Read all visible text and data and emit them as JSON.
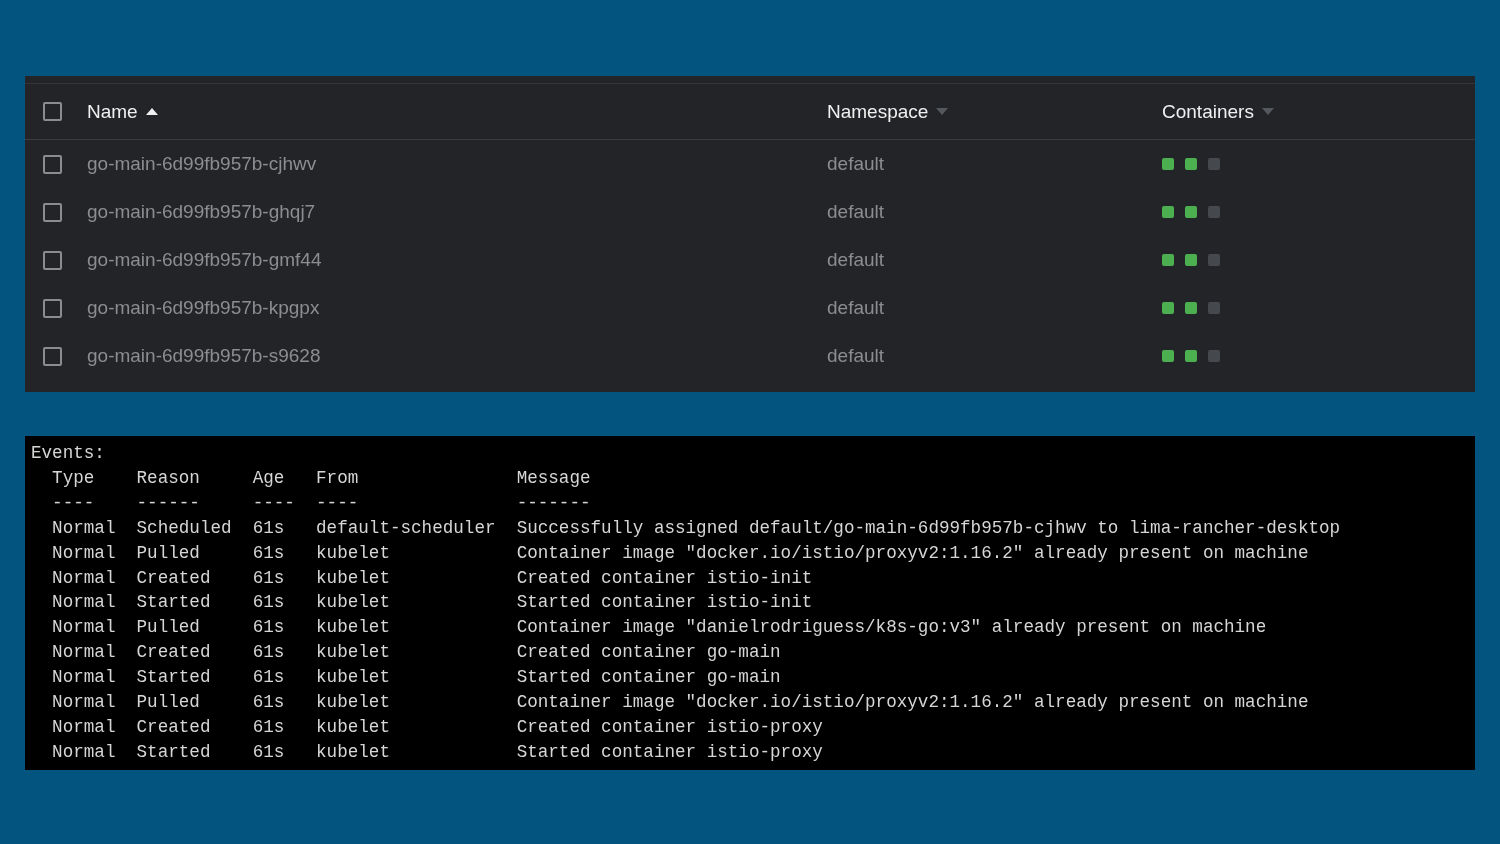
{
  "pods_table": {
    "select_all": {
      "checked": false
    },
    "columns": [
      {
        "label": "Name",
        "sorted": true
      },
      {
        "label": "Namespace",
        "sorted": false
      },
      {
        "label": "Containers",
        "sorted": false
      }
    ],
    "rows": [
      {
        "checked": false,
        "name": "go-main-6d99fb957b-cjhwv",
        "namespace": "default",
        "containers": [
          {
            "color": "#4cb050"
          },
          {
            "color": "#4cb050"
          },
          {
            "color": "#45484d"
          }
        ]
      },
      {
        "checked": false,
        "name": "go-main-6d99fb957b-ghqj7",
        "namespace": "default",
        "containers": [
          {
            "color": "#4cb050"
          },
          {
            "color": "#4cb050"
          },
          {
            "color": "#45484d"
          }
        ]
      },
      {
        "checked": false,
        "name": "go-main-6d99fb957b-gmf44",
        "namespace": "default",
        "containers": [
          {
            "color": "#4cb050"
          },
          {
            "color": "#4cb050"
          },
          {
            "color": "#45484d"
          }
        ]
      },
      {
        "checked": false,
        "name": "go-main-6d99fb957b-kpgpx",
        "namespace": "default",
        "containers": [
          {
            "color": "#4cb050"
          },
          {
            "color": "#4cb050"
          },
          {
            "color": "#45484d"
          }
        ]
      },
      {
        "checked": false,
        "name": "go-main-6d99fb957b-s9628",
        "namespace": "default",
        "containers": [
          {
            "color": "#4cb050"
          },
          {
            "color": "#4cb050"
          },
          {
            "color": "#45484d"
          }
        ]
      }
    ]
  },
  "terminal": {
    "title": "Events:",
    "columns": [
      "Type",
      "Reason",
      "Age",
      "From",
      "Message"
    ],
    "underlines": [
      "----",
      "------",
      "----",
      "----",
      "-------"
    ],
    "events": [
      [
        "Normal",
        "Scheduled",
        "61s",
        "default-scheduler",
        "Successfully assigned default/go-main-6d99fb957b-cjhwv to lima-rancher-desktop"
      ],
      [
        "Normal",
        "Pulled",
        "61s",
        "kubelet",
        "Container image \"docker.io/istio/proxyv2:1.16.2\" already present on machine"
      ],
      [
        "Normal",
        "Created",
        "61s",
        "kubelet",
        "Created container istio-init"
      ],
      [
        "Normal",
        "Started",
        "61s",
        "kubelet",
        "Started container istio-init"
      ],
      [
        "Normal",
        "Pulled",
        "61s",
        "kubelet",
        "Container image \"danielrodriguess/k8s-go:v3\" already present on machine"
      ],
      [
        "Normal",
        "Created",
        "61s",
        "kubelet",
        "Created container go-main"
      ],
      [
        "Normal",
        "Started",
        "61s",
        "kubelet",
        "Started container go-main"
      ],
      [
        "Normal",
        "Pulled",
        "61s",
        "kubelet",
        "Container image \"docker.io/istio/proxyv2:1.16.2\" already present on machine"
      ],
      [
        "Normal",
        "Created",
        "61s",
        "kubelet",
        "Created container istio-proxy"
      ],
      [
        "Normal",
        "Started",
        "61s",
        "kubelet",
        "Started container istio-proxy"
      ]
    ]
  }
}
